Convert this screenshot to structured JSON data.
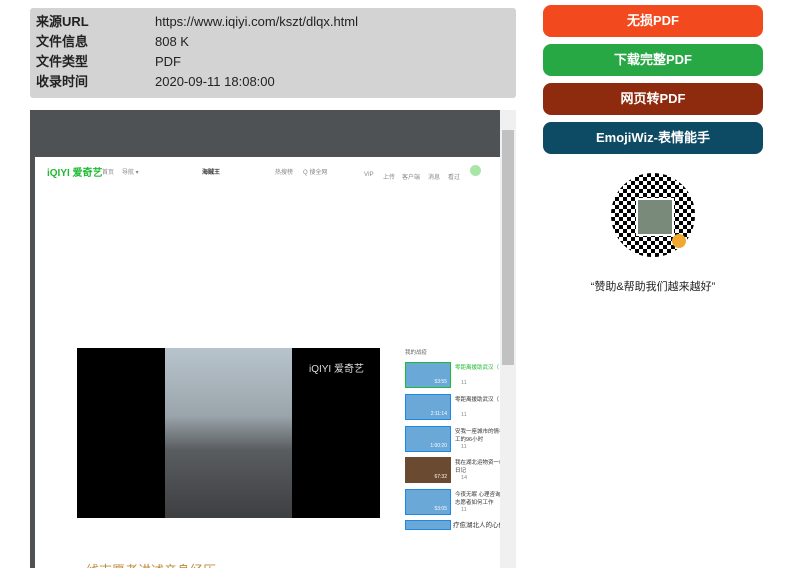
{
  "info": [
    {
      "label": "来源URL",
      "value": "https://www.iqiyi.com/kszt/dlqx.html"
    },
    {
      "label": "文件信息",
      "value": "808 K"
    },
    {
      "label": "文件类型",
      "value": "PDF"
    },
    {
      "label": "收录时间",
      "value": "2020-09-11 18:08:00"
    }
  ],
  "preview": {
    "nav": {
      "logo": "iQIYI 爱奇艺",
      "home": "首页",
      "guide": "导航 ▾",
      "title": "海贼王",
      "hot": "热搜榜",
      "search": "Q 搜全网",
      "vip": "VIP",
      "upload": "上传",
      "client": "客户端",
      "msg": "消息",
      "history": "看过"
    },
    "video_logo": "iQIYI 爱奇艺",
    "side_title": "我的战疫",
    "items": [
      {
        "title": "零距离援助武汉（",
        "count": "11",
        "dur": "53:55"
      },
      {
        "title": "零距离援助武汉（",
        "count": "11",
        "dur": "2:11:14"
      },
      {
        "title": "安我一座城市的情社工的96小时",
        "count": "11",
        "dur": "1:00:20"
      },
      {
        "title": "我在湖北运物资一线日记",
        "count": "14",
        "dur": "67:32"
      },
      {
        "title": "今夜无眠 心理咨询志愿者如何工作",
        "count": "11",
        "dur": "53:05"
      },
      {
        "title": "疗愈湖北人的心伤",
        "count": "",
        "dur": ""
      }
    ],
    "headline": "一线志愿者讲述亲身经历"
  },
  "buttons": [
    {
      "label": "无损PDF",
      "color": "#f24a1e"
    },
    {
      "label": "下载完整PDF",
      "color": "#27a844"
    },
    {
      "label": "网页转PDF",
      "color": "#8e2a0d"
    },
    {
      "label": "EmojiWiz-表情能手",
      "color": "#0d4a63"
    }
  ],
  "caption": "“赞助&帮助我们越来越好”"
}
